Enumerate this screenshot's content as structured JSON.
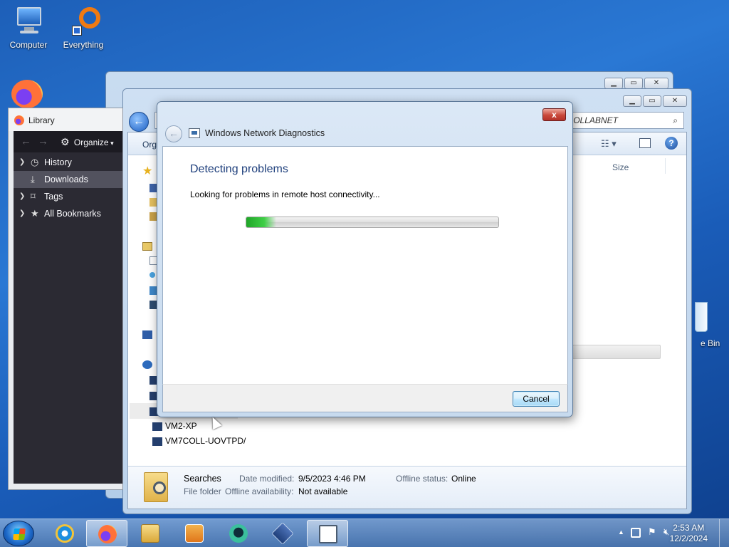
{
  "desktop": {
    "icons": [
      {
        "label": "Computer",
        "icon": "computer-icon"
      },
      {
        "label": "Everything",
        "icon": "everything-search-icon"
      }
    ],
    "partial_labels": {
      "recycle_bin": "e Bin"
    }
  },
  "library": {
    "title": "Library",
    "organize_label": "Organize",
    "items": [
      {
        "label": "History",
        "icon": "clock-icon",
        "expandable": true
      },
      {
        "label": "Downloads",
        "icon": "download-icon",
        "expandable": false,
        "selected": true
      },
      {
        "label": "Tags",
        "icon": "tag-icon",
        "expandable": true
      },
      {
        "label": "All Bookmarks",
        "icon": "star-icon",
        "expandable": true
      }
    ]
  },
  "explorer": {
    "address_tail": "OLLABNET",
    "toolbar_partial": "Orga",
    "column_size": "Size",
    "nav_items": [
      {
        "label": "VM2-XP"
      },
      {
        "label": "VM7COLL-UOVTPD/"
      }
    ],
    "details": {
      "name": "Searches",
      "type": "File folder",
      "date_modified_label": "Date modified:",
      "date_modified": "9/5/2023 4:46 PM",
      "offline_status_label": "Offline status:",
      "offline_status": "Online",
      "offline_availability_label": "Offline availability:",
      "offline_availability": "Not available"
    }
  },
  "dialog": {
    "title": "Windows Network Diagnostics",
    "heading": "Detecting problems",
    "description": "Looking for problems in remote host connectivity...",
    "progress_fraction": 0.12,
    "cancel_label": "Cancel",
    "close_label": "x"
  },
  "taskbar": {
    "apps": [
      {
        "name": "internet-explorer-icon",
        "active": false
      },
      {
        "name": "firefox-icon",
        "active": true
      },
      {
        "name": "file-explorer-icon",
        "active": false
      },
      {
        "name": "media-player-icon",
        "active": false
      },
      {
        "name": "chat-app-icon",
        "active": false
      },
      {
        "name": "virtualbox-icon",
        "active": false
      },
      {
        "name": "network-diagnostics-icon",
        "active": true
      }
    ],
    "clock": {
      "time": "2:53 AM",
      "date": "12/2/2024"
    }
  },
  "colors": {
    "desktop_blue": "#1d5fb8",
    "dialog_heading": "#1e3f7c",
    "progress_green": "#3fcf46",
    "firefox_dark": "#2b2a33"
  }
}
